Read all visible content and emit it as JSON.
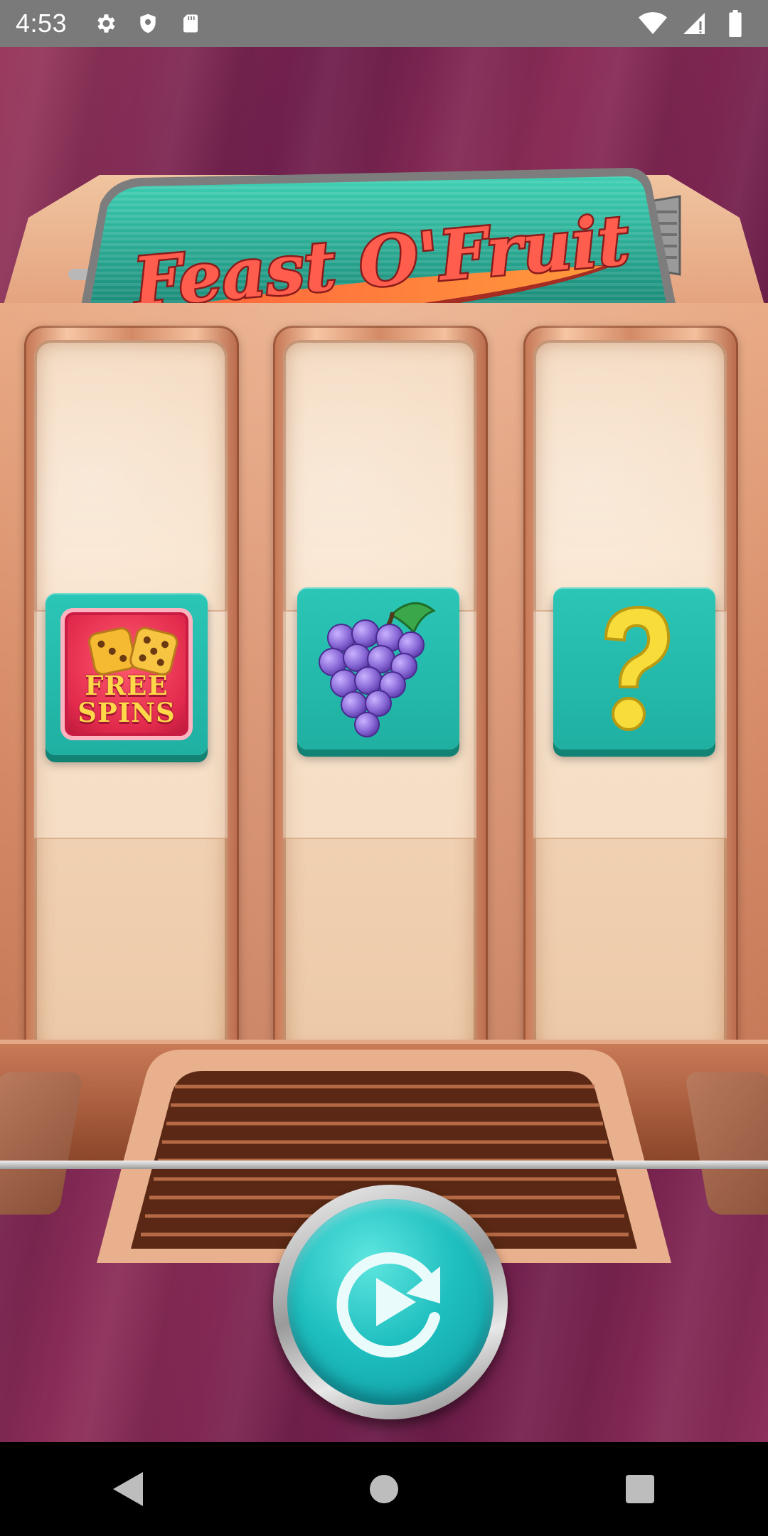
{
  "status_bar": {
    "time": "4:53",
    "left_icons": [
      "gear-icon",
      "shield-icon",
      "sd-card-icon"
    ],
    "right_icons": [
      "wifi-icon",
      "signal-icon",
      "battery-icon"
    ]
  },
  "game": {
    "title": "Feast O'Fruit",
    "reels": [
      {
        "symbol": "free-spins",
        "label": [
          "FREE",
          "SPINS"
        ]
      },
      {
        "symbol": "grapes"
      },
      {
        "symbol": "question-mark"
      }
    ],
    "spin_button_icon": "replay-play-icon",
    "colors": {
      "background": "#7a234f",
      "cabinet": "#e6a783",
      "symbol_tile": "#22bbad",
      "title_sign": "#1e9f88",
      "spin_button": "#1fbfbf"
    }
  },
  "nav_bar": {
    "buttons": [
      "back-icon",
      "home-icon",
      "recents-icon"
    ]
  }
}
